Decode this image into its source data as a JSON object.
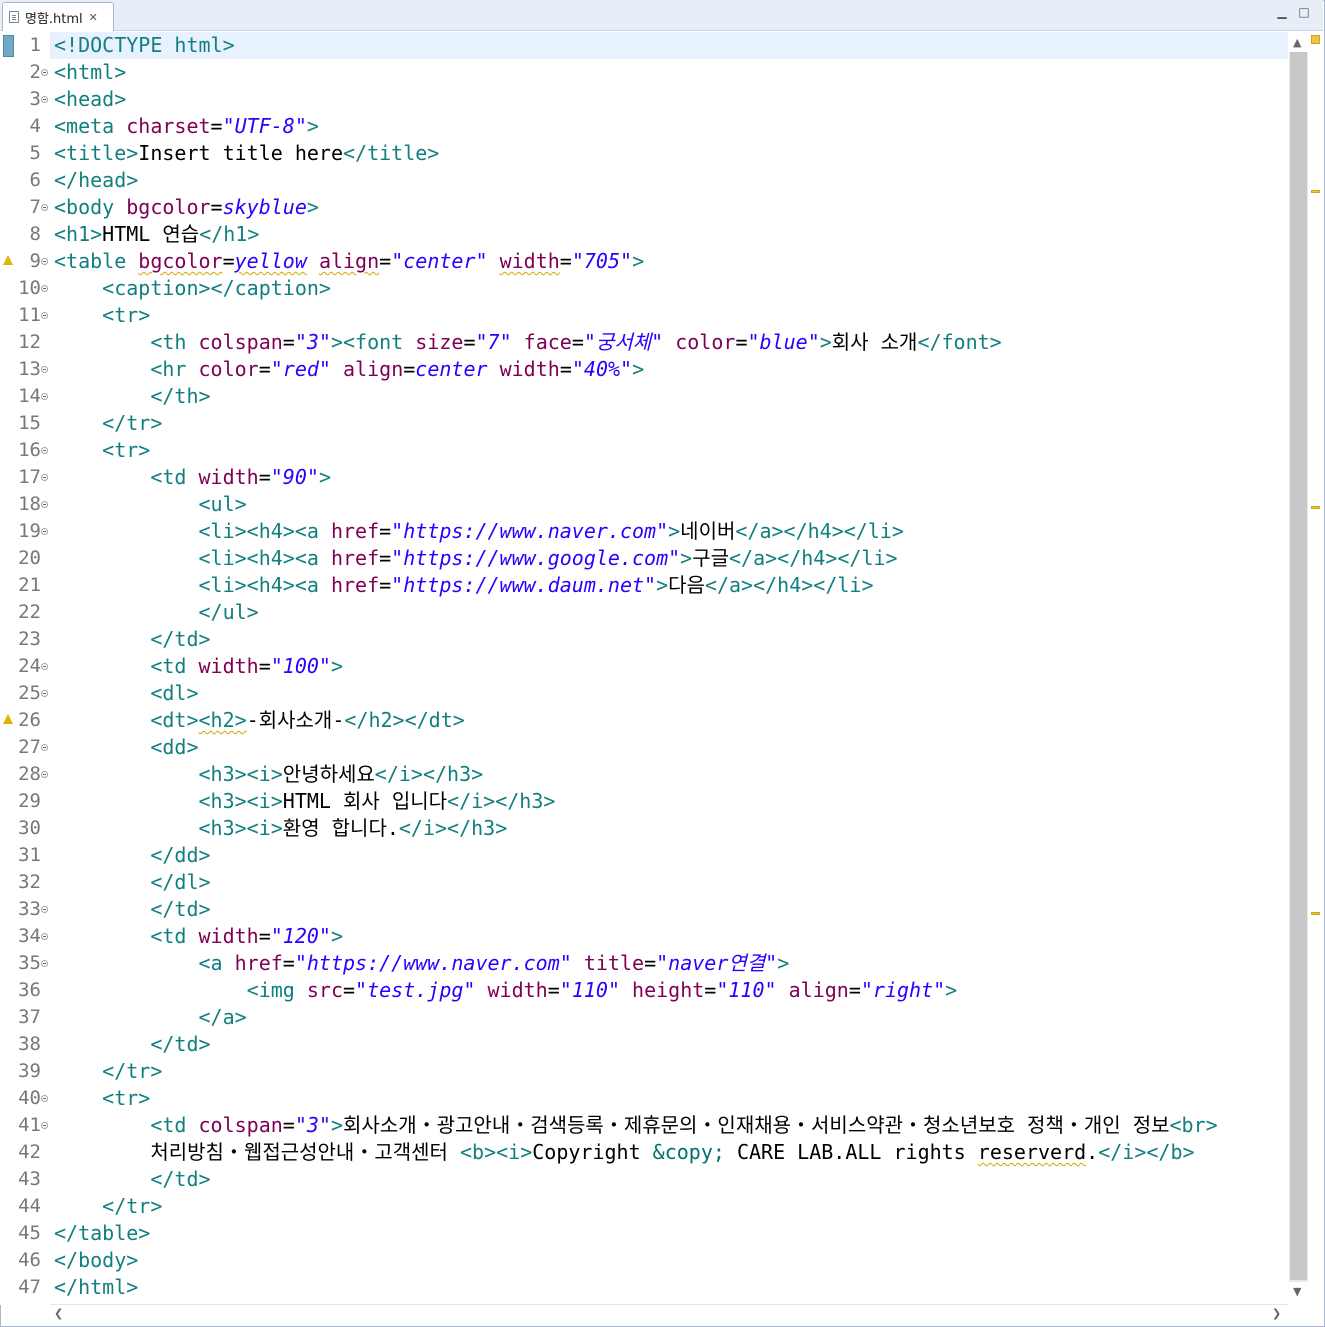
{
  "tab": {
    "label": "명함.html",
    "close": "✕"
  },
  "window_buttons": {
    "minimize": "▁",
    "maximize": "□"
  },
  "lines": [
    {
      "n": "1",
      "fold": false,
      "warn": false,
      "current": true,
      "tokens": [
        [
          "t",
          "<!DOCTYPE html>"
        ]
      ]
    },
    {
      "n": "2",
      "fold": true,
      "tokens": [
        [
          "t",
          "<html>"
        ]
      ]
    },
    {
      "n": "3",
      "fold": true,
      "tokens": [
        [
          "t",
          "<head>"
        ]
      ]
    },
    {
      "n": "4",
      "tokens": [
        [
          "t",
          "<meta "
        ],
        [
          "a",
          "charset"
        ],
        [
          "x",
          "="
        ],
        [
          "v",
          "\"UTF-8\""
        ],
        [
          "t",
          ">"
        ]
      ]
    },
    {
      "n": "5",
      "tokens": [
        [
          "t",
          "<title>"
        ],
        [
          "x",
          "Insert title here"
        ],
        [
          "t",
          "</title>"
        ]
      ]
    },
    {
      "n": "6",
      "tokens": [
        [
          "t",
          "</head>"
        ]
      ]
    },
    {
      "n": "7",
      "fold": true,
      "tokens": [
        [
          "t",
          "<body "
        ],
        [
          "a",
          "bgcolor"
        ],
        [
          "x",
          "="
        ],
        [
          "v",
          "skyblue"
        ],
        [
          "t",
          ">"
        ]
      ]
    },
    {
      "n": "8",
      "tokens": [
        [
          "t",
          "<h1>"
        ],
        [
          "x",
          "HTML 연습"
        ],
        [
          "t",
          "</h1>"
        ]
      ]
    },
    {
      "n": "9",
      "fold": true,
      "warn": true,
      "tokens": [
        [
          "t",
          "<table "
        ],
        [
          "a sq",
          "bgcolor"
        ],
        [
          "x",
          "="
        ],
        [
          "v sq",
          "yellow"
        ],
        [
          "x",
          " "
        ],
        [
          "a sq",
          "align"
        ],
        [
          "x",
          "="
        ],
        [
          "v",
          "\"center\""
        ],
        [
          "x",
          " "
        ],
        [
          "a sq",
          "width"
        ],
        [
          "x",
          "="
        ],
        [
          "v",
          "\"705\""
        ],
        [
          "t",
          ">"
        ]
      ]
    },
    {
      "n": "10",
      "fold": true,
      "tokens": [
        [
          "x",
          "    "
        ],
        [
          "t",
          "<caption></caption>"
        ]
      ]
    },
    {
      "n": "11",
      "fold": true,
      "tokens": [
        [
          "x",
          "    "
        ],
        [
          "t",
          "<tr>"
        ]
      ]
    },
    {
      "n": "12",
      "tokens": [
        [
          "x",
          "        "
        ],
        [
          "t",
          "<th "
        ],
        [
          "a",
          "colspan"
        ],
        [
          "x",
          "="
        ],
        [
          "v",
          "\"3\""
        ],
        [
          "t",
          "><font "
        ],
        [
          "a",
          "size"
        ],
        [
          "x",
          "="
        ],
        [
          "v",
          "\"7\""
        ],
        [
          "x",
          " "
        ],
        [
          "a",
          "face"
        ],
        [
          "x",
          "="
        ],
        [
          "v",
          "\"궁서체\""
        ],
        [
          "x",
          " "
        ],
        [
          "a",
          "color"
        ],
        [
          "x",
          "="
        ],
        [
          "v",
          "\"blue\""
        ],
        [
          "t",
          ">"
        ],
        [
          "x",
          "회사 소개"
        ],
        [
          "t",
          "</font>"
        ]
      ]
    },
    {
      "n": "13",
      "fold": true,
      "tokens": [
        [
          "x",
          "        "
        ],
        [
          "t",
          "<hr "
        ],
        [
          "a",
          "color"
        ],
        [
          "x",
          "="
        ],
        [
          "v",
          "\"red\""
        ],
        [
          "x",
          " "
        ],
        [
          "a",
          "align"
        ],
        [
          "x",
          "="
        ],
        [
          "v",
          "center"
        ],
        [
          "x",
          " "
        ],
        [
          "a",
          "width"
        ],
        [
          "x",
          "="
        ],
        [
          "v",
          "\"40%\""
        ],
        [
          "t",
          ">"
        ]
      ]
    },
    {
      "n": "14",
      "fold": true,
      "tokens": [
        [
          "x",
          "        "
        ],
        [
          "t",
          "</th>"
        ]
      ]
    },
    {
      "n": "15",
      "tokens": [
        [
          "x",
          "    "
        ],
        [
          "t",
          "</tr>"
        ]
      ]
    },
    {
      "n": "16",
      "fold": true,
      "tokens": [
        [
          "x",
          "    "
        ],
        [
          "t",
          "<tr>"
        ]
      ]
    },
    {
      "n": "17",
      "fold": true,
      "tokens": [
        [
          "x",
          "        "
        ],
        [
          "t",
          "<td "
        ],
        [
          "a",
          "width"
        ],
        [
          "x",
          "="
        ],
        [
          "v",
          "\"90\""
        ],
        [
          "t",
          ">"
        ]
      ]
    },
    {
      "n": "18",
      "fold": true,
      "tokens": [
        [
          "x",
          "            "
        ],
        [
          "t",
          "<ul>"
        ]
      ]
    },
    {
      "n": "19",
      "fold": true,
      "tokens": [
        [
          "x",
          "            "
        ],
        [
          "t",
          "<li><h4><a "
        ],
        [
          "a",
          "href"
        ],
        [
          "x",
          "="
        ],
        [
          "v",
          "\"https://www.naver.com\""
        ],
        [
          "t",
          ">"
        ],
        [
          "x",
          "네이버"
        ],
        [
          "t",
          "</a></h4></li>"
        ]
      ]
    },
    {
      "n": "20",
      "tokens": [
        [
          "x",
          "            "
        ],
        [
          "t",
          "<li><h4><a "
        ],
        [
          "a",
          "href"
        ],
        [
          "x",
          "="
        ],
        [
          "v",
          "\"https://www.google.com\""
        ],
        [
          "t",
          ">"
        ],
        [
          "x",
          "구글"
        ],
        [
          "t",
          "</a></h4></li>"
        ]
      ]
    },
    {
      "n": "21",
      "tokens": [
        [
          "x",
          "            "
        ],
        [
          "t",
          "<li><h4><a "
        ],
        [
          "a",
          "href"
        ],
        [
          "x",
          "="
        ],
        [
          "v",
          "\"https://www.daum.net\""
        ],
        [
          "t",
          ">"
        ],
        [
          "x",
          "다음"
        ],
        [
          "t",
          "</a></h4></li>"
        ]
      ]
    },
    {
      "n": "22",
      "tokens": [
        [
          "x",
          "            "
        ],
        [
          "t",
          "</ul>"
        ]
      ]
    },
    {
      "n": "23",
      "tokens": [
        [
          "x",
          "        "
        ],
        [
          "t",
          "</td>"
        ]
      ]
    },
    {
      "n": "24",
      "fold": true,
      "tokens": [
        [
          "x",
          "        "
        ],
        [
          "t",
          "<td "
        ],
        [
          "a",
          "width"
        ],
        [
          "x",
          "="
        ],
        [
          "v",
          "\"100\""
        ],
        [
          "t",
          ">"
        ]
      ]
    },
    {
      "n": "25",
      "fold": true,
      "tokens": [
        [
          "x",
          "        "
        ],
        [
          "t",
          "<dl>"
        ]
      ]
    },
    {
      "n": "26",
      "warn": true,
      "tokens": [
        [
          "x",
          "        "
        ],
        [
          "t",
          "<dt>"
        ],
        [
          "t sq",
          "<h2>"
        ],
        [
          "x",
          "-회사소개-"
        ],
        [
          "t",
          "</h2></dt>"
        ]
      ]
    },
    {
      "n": "27",
      "fold": true,
      "tokens": [
        [
          "x",
          "        "
        ],
        [
          "t",
          "<dd>"
        ]
      ]
    },
    {
      "n": "28",
      "fold": true,
      "tokens": [
        [
          "x",
          "            "
        ],
        [
          "t",
          "<h3><i>"
        ],
        [
          "x",
          "안녕하세요"
        ],
        [
          "t",
          "</i></h3>"
        ]
      ]
    },
    {
      "n": "29",
      "tokens": [
        [
          "x",
          "            "
        ],
        [
          "t",
          "<h3><i>"
        ],
        [
          "x",
          "HTML 회사 입니다"
        ],
        [
          "t",
          "</i></h3>"
        ]
      ]
    },
    {
      "n": "30",
      "tokens": [
        [
          "x",
          "            "
        ],
        [
          "t",
          "<h3><i>"
        ],
        [
          "x",
          "환영 합니다."
        ],
        [
          "t",
          "</i></h3>"
        ]
      ]
    },
    {
      "n": "31",
      "tokens": [
        [
          "x",
          "        "
        ],
        [
          "t",
          "</dd>"
        ]
      ]
    },
    {
      "n": "32",
      "tokens": [
        [
          "x",
          "        "
        ],
        [
          "t",
          "</dl>"
        ]
      ]
    },
    {
      "n": "33",
      "fold": true,
      "tokens": [
        [
          "x",
          "        "
        ],
        [
          "t",
          "</td>"
        ]
      ]
    },
    {
      "n": "34",
      "fold": true,
      "tokens": [
        [
          "x",
          "        "
        ],
        [
          "t",
          "<td "
        ],
        [
          "a",
          "width"
        ],
        [
          "x",
          "="
        ],
        [
          "v",
          "\"120\""
        ],
        [
          "t",
          ">"
        ]
      ]
    },
    {
      "n": "35",
      "fold": true,
      "tokens": [
        [
          "x",
          "            "
        ],
        [
          "t",
          "<a "
        ],
        [
          "a",
          "href"
        ],
        [
          "x",
          "="
        ],
        [
          "v",
          "\"https://www.naver.com\""
        ],
        [
          "x",
          " "
        ],
        [
          "a",
          "title"
        ],
        [
          "x",
          "="
        ],
        [
          "v",
          "\"naver연결\""
        ],
        [
          "t",
          ">"
        ]
      ]
    },
    {
      "n": "36",
      "tokens": [
        [
          "x",
          "                "
        ],
        [
          "t",
          "<img "
        ],
        [
          "a",
          "src"
        ],
        [
          "x",
          "="
        ],
        [
          "v",
          "\"test.jpg\""
        ],
        [
          "x",
          " "
        ],
        [
          "a",
          "width"
        ],
        [
          "x",
          "="
        ],
        [
          "v",
          "\"110\""
        ],
        [
          "x",
          " "
        ],
        [
          "a",
          "height"
        ],
        [
          "x",
          "="
        ],
        [
          "v",
          "\"110\""
        ],
        [
          "x",
          " "
        ],
        [
          "a",
          "align"
        ],
        [
          "x",
          "="
        ],
        [
          "v",
          "\"right\""
        ],
        [
          "t",
          ">"
        ]
      ]
    },
    {
      "n": "37",
      "tokens": [
        [
          "x",
          "            "
        ],
        [
          "t",
          "</a>"
        ]
      ]
    },
    {
      "n": "38",
      "tokens": [
        [
          "x",
          "        "
        ],
        [
          "t",
          "</td>"
        ]
      ]
    },
    {
      "n": "39",
      "tokens": [
        [
          "x",
          "    "
        ],
        [
          "t",
          "</tr>"
        ]
      ]
    },
    {
      "n": "40",
      "fold": true,
      "tokens": [
        [
          "x",
          "    "
        ],
        [
          "t",
          "<tr>"
        ]
      ]
    },
    {
      "n": "41",
      "fold": true,
      "tokens": [
        [
          "x",
          "        "
        ],
        [
          "t",
          "<td "
        ],
        [
          "a",
          "colspan"
        ],
        [
          "x",
          "="
        ],
        [
          "v",
          "\"3\""
        ],
        [
          "t",
          ">"
        ],
        [
          "x",
          "회사소개・광고안내・검색등록・제휴문의・인재채용・서비스약관・청소년보호 정책・개인 정보"
        ],
        [
          "t",
          "<br>"
        ]
      ]
    },
    {
      "n": "42",
      "tokens": [
        [
          "x",
          "        처리방침・웹접근성안내・고객센터 "
        ],
        [
          "t",
          "<b><i>"
        ],
        [
          "x",
          "Copyright "
        ],
        [
          "e",
          "&copy;"
        ],
        [
          "x",
          " CARE LAB.ALL rights "
        ],
        [
          "x sq",
          "reserverd"
        ],
        [
          "x",
          "."
        ],
        [
          "t",
          "</i></b>"
        ]
      ]
    },
    {
      "n": "43",
      "tokens": [
        [
          "x",
          "        "
        ],
        [
          "t",
          "</td>"
        ]
      ]
    },
    {
      "n": "44",
      "tokens": [
        [
          "x",
          "    "
        ],
        [
          "t",
          "</tr>"
        ]
      ]
    },
    {
      "n": "45",
      "tokens": [
        [
          "t",
          "</table>"
        ]
      ]
    },
    {
      "n": "46",
      "tokens": [
        [
          "t",
          "</body>"
        ]
      ]
    },
    {
      "n": "47",
      "tokens": [
        [
          "t",
          "</html>"
        ]
      ]
    }
  ]
}
